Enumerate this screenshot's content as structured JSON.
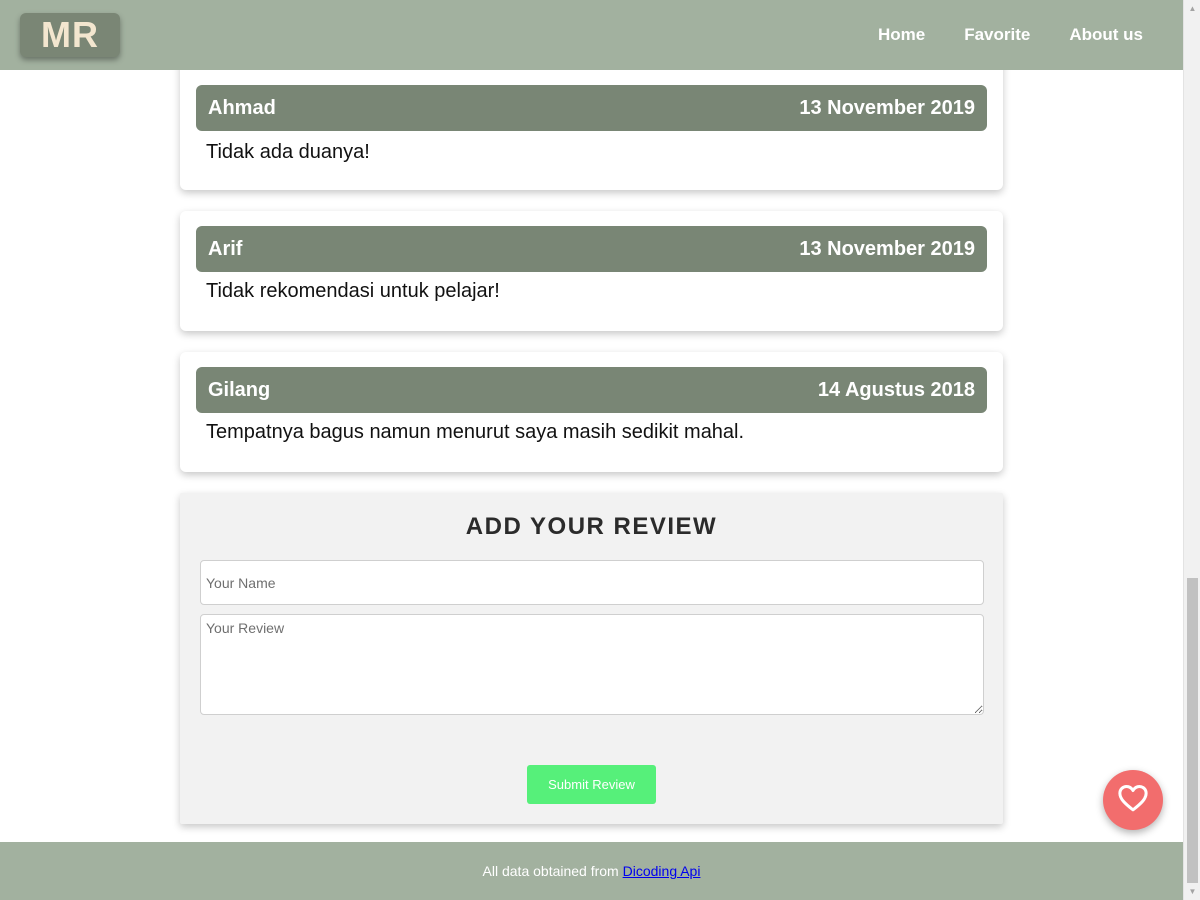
{
  "header": {
    "logo": "MR",
    "nav": [
      "Home",
      "Favorite",
      "About us"
    ]
  },
  "reviews": [
    {
      "name": "Ahmad",
      "date": "13 November 2019",
      "text": "Tidak ada duanya!"
    },
    {
      "name": "Arif",
      "date": "13 November 2019",
      "text": "Tidak rekomendasi untuk pelajar!"
    },
    {
      "name": "Gilang",
      "date": "14 Agustus 2018",
      "text": "Tempatnya bagus namun menurut saya masih sedikit mahal."
    }
  ],
  "form": {
    "title": "ADD YOUR REVIEW",
    "name_placeholder": "Your Name",
    "review_placeholder": "Your Review",
    "submit_label": "Submit Review"
  },
  "footer": {
    "text": "All data obtained from ",
    "link": "Dicoding Api"
  },
  "fab": {
    "icon": "heart-icon"
  },
  "colors": {
    "header_bg": "#a2b19f",
    "card_head_bg": "#798675",
    "submit_bg": "#56f07a",
    "fab_bg": "#f26d6d"
  }
}
